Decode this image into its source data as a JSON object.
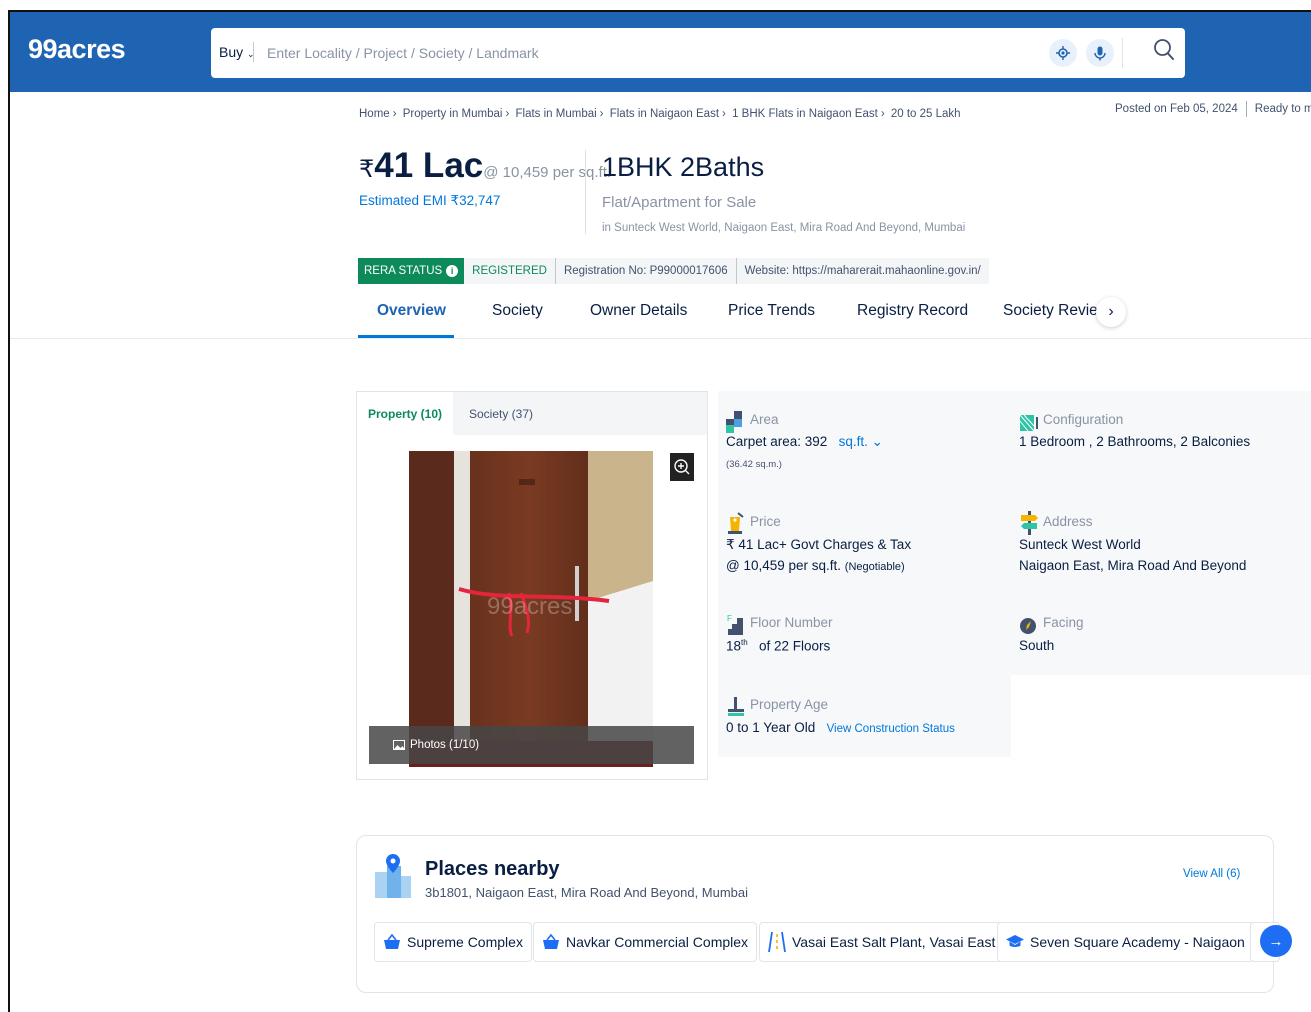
{
  "header": {
    "logo": "99acres",
    "buy_label": "Buy",
    "search_placeholder": "Enter Locality / Project / Society / Landmark"
  },
  "breadcrumb": [
    "Home",
    "Property in Mumbai",
    "Flats in Mumbai",
    "Flats in Naigaon East",
    "1 BHK Flats in Naigaon East",
    "20 to 25 Lakh"
  ],
  "posted": {
    "date": "Posted on Feb 05, 2024",
    "status": "Ready to mov"
  },
  "listing": {
    "rupee": "₹",
    "price": "41 Lac",
    "per_sqft": "@ 10,459 per sq.ft.",
    "emi": "Estimated EMI ₹32,747",
    "title": "1BHK 2Baths",
    "subtitle": "Flat/Apartment for Sale",
    "location": "in Sunteck West World, Naigaon East, Mira Road And Beyond, Mumbai"
  },
  "rera": {
    "status_label": "RERA STATUS",
    "info_icon": "i",
    "registered": "REGISTERED",
    "registration": "Registration No: P99000017606",
    "website": "Website: https://maharerait.mahaonline.gov.in/"
  },
  "tabs": [
    "Overview",
    "Society",
    "Owner Details",
    "Price Trends",
    "Registry Record",
    "Society Reviews"
  ],
  "gallery": {
    "tab_property": "Property (10)",
    "tab_society": "Society (37)",
    "photos_label": "Photos (1/10)",
    "watermark": "99acres"
  },
  "details": {
    "area_label": "Area",
    "area_value": "Carpet area: 392",
    "area_unit": "sq.ft.",
    "area_sqm": "(36.42 sq.m.)",
    "config_label": "Configuration",
    "config_value": "1 Bedroom , 2 Bathrooms, 2 Balconies",
    "price_label": "Price",
    "price_value": "₹ 41 Lac+ Govt Charges & Tax",
    "price_persq": "@ 10,459 per sq.ft.",
    "price_neg": "(Negotiable)",
    "address_label": "Address",
    "address_line1": "Sunteck West World",
    "address_line2": "Naigaon East, Mira Road And Beyond",
    "floor_label": "Floor Number",
    "floor_num": "18",
    "floor_sup": "th",
    "floor_of": "of 22 Floors",
    "facing_label": "Facing",
    "facing_value": "South",
    "age_label": "Property Age",
    "age_value": "0 to 1 Year Old",
    "construction_link": "View Construction Status"
  },
  "places": {
    "title": "Places nearby",
    "address": "3b1801, Naigaon East, Mira Road And Beyond, Mumbai",
    "view_all": "View All (6)",
    "items": [
      "Supreme Complex",
      "Navkar Commercial Complex",
      "Vasai East Salt Plant, Vasai East",
      "Seven Square Academy - Naigaon"
    ]
  },
  "colors": {
    "brand_blue": "#1f64b2",
    "link_blue": "#0078db",
    "rera_green": "#0c8a5a"
  }
}
